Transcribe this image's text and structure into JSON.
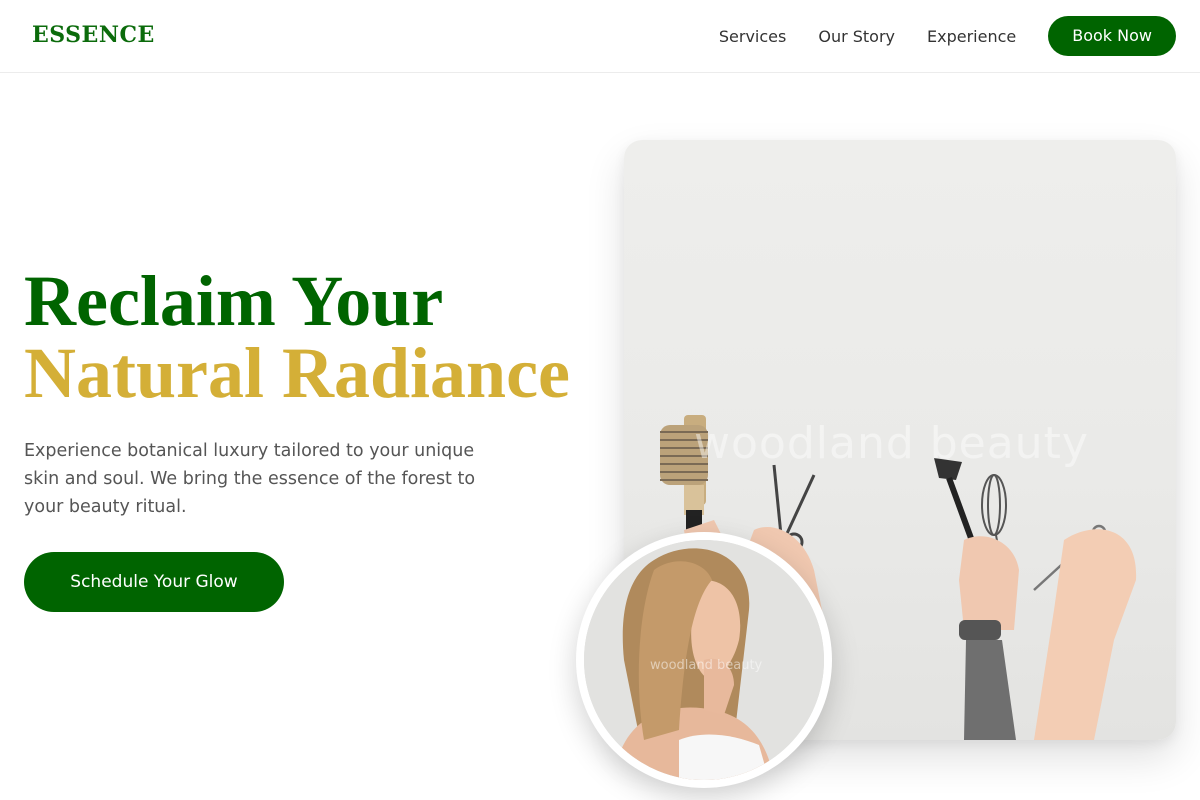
{
  "header": {
    "logo": "ESSENCE",
    "nav": {
      "services": "Services",
      "our_story": "Our Story",
      "experience": "Experience"
    },
    "book_now": "Book Now"
  },
  "hero": {
    "title_line1": "Reclaim Your",
    "title_line2": "Natural Radiance",
    "description": "Experience botanical luxury tailored to your unique skin and soul. We bring the essence of the forest to your beauty ritual.",
    "cta": "Schedule Your Glow"
  },
  "media": {
    "main_image_watermark": "woodland beauty",
    "portrait_watermark": "woodland beauty"
  },
  "colors": {
    "brand_green": "#006400",
    "gold": "#d4af37",
    "text_gray": "#555555"
  }
}
